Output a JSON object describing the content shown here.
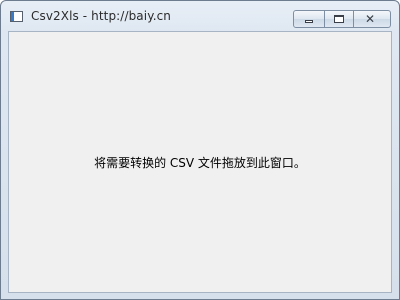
{
  "window": {
    "title": "Csv2Xls - http://baiy.cn",
    "icon": "app-window-icon",
    "controls": {
      "minimize_icon": "minimize-icon",
      "maximize_icon": "maximize-icon",
      "close_icon": "close-icon",
      "close_glyph": "✕"
    }
  },
  "main": {
    "drop_hint": "将需要转换的 CSV 文件拖放到此窗口。"
  }
}
